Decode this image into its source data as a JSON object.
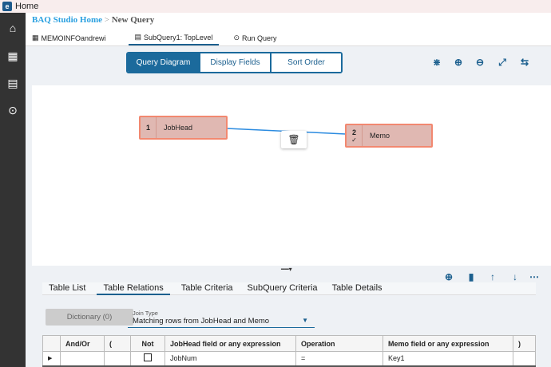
{
  "window": {
    "title": "Home"
  },
  "sidebar": {
    "items": [
      {
        "icon": "home-icon"
      },
      {
        "icon": "grid-icon"
      },
      {
        "icon": "report-icon"
      },
      {
        "icon": "play-icon"
      }
    ]
  },
  "breadcrumb": {
    "home": "BAQ Studio Home",
    "sep": ">",
    "current": "New Query"
  },
  "top_tabs": [
    {
      "label": "MEMOINFOandrewi",
      "icon": "table-icon"
    },
    {
      "label": "SubQuery1: TopLevel",
      "icon": "document-icon",
      "active": true
    },
    {
      "label": "Run Query",
      "icon": "play-icon"
    }
  ],
  "view_toggle": [
    {
      "label": "Query Diagram",
      "active": true
    },
    {
      "label": "Display Fields"
    },
    {
      "label": "Sort Order"
    }
  ],
  "diagram_tools": [
    "collapse-icon",
    "zoom-in-icon",
    "zoom-out-icon",
    "expand-icon",
    "route-icon"
  ],
  "diagram": {
    "nodes": [
      {
        "num": "1",
        "name": "JobHead"
      },
      {
        "num": "2",
        "name": "Memo",
        "checked": true
      }
    ],
    "colors": {
      "node_fill": "#e0b8b2",
      "node_border": "#f28870",
      "link": "#2b8be0"
    }
  },
  "bottom_tools": [
    "add-icon",
    "trash-icon",
    "arrow-up-icon",
    "arrow-down-icon",
    "more-icon"
  ],
  "bottom_tabs": [
    {
      "label": "Table List"
    },
    {
      "label": "Table Relations",
      "active": true
    },
    {
      "label": "Table Criteria"
    },
    {
      "label": "SubQuery Criteria"
    },
    {
      "label": "Table Details"
    }
  ],
  "dictionary_button": "Dictionary (0)",
  "join_type": {
    "label": "Join Type",
    "value": "Matching rows from JobHead and Memo"
  },
  "relations_table": {
    "columns": [
      "",
      "And/Or",
      "(",
      "Not",
      "JobHead field or any expression",
      "Operation",
      "Memo field or any expression",
      ")"
    ],
    "rows": [
      {
        "and_or": "",
        "open": "",
        "not": false,
        "left": "JobNum",
        "op": "=",
        "right": "Key1",
        "close": ""
      }
    ]
  }
}
